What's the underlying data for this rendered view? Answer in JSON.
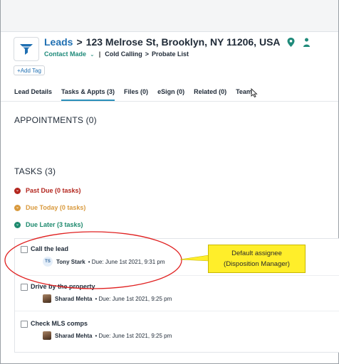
{
  "header": {
    "lead_link": "Leads",
    "separator": ">",
    "address": "123 Melrose St, Brooklyn, NY 11206, USA",
    "status": "Contact Made",
    "status_chevron": "⌄",
    "breadcrumb_divider": "|",
    "breadcrumb_1": "Cold Calling",
    "breadcrumb_arrow": ">",
    "breadcrumb_2": "Probate List",
    "add_tag": "+Add Tag",
    "icons": [
      "funnel-icon",
      "map-pin-icon",
      "person-icon"
    ]
  },
  "tabs": [
    {
      "label": "Lead Details",
      "active": false
    },
    {
      "label": "Tasks & Appts (3)",
      "active": true
    },
    {
      "label": "Files (0)",
      "active": false
    },
    {
      "label": "eSign (0)",
      "active": false
    },
    {
      "label": "Related (0)",
      "active": false
    },
    {
      "label": "Team",
      "active": false
    }
  ],
  "appointments": {
    "heading": "APPOINTMENTS (0)"
  },
  "tasks": {
    "heading": "TASKS (3)",
    "groups": [
      {
        "label": "Past Due (0 tasks)",
        "color": "#b3261e"
      },
      {
        "label": "Due Today (0 tasks)",
        "color": "#d99a3e"
      },
      {
        "label": "Due Later (3 tasks)",
        "color": "#1e8a6e"
      }
    ],
    "group_chevron": "⌄",
    "items": [
      {
        "title": "Call the lead",
        "avatar": "TS",
        "assignee": "Tony Stark",
        "due": "• Due: June 1st 2021, 9:31 pm"
      },
      {
        "title": "Drive by the property",
        "avatar": "photo",
        "assignee": "Sharad Mehta",
        "due": "• Due: June 1st 2021, 9:25 pm"
      },
      {
        "title": "Check MLS comps",
        "avatar": "photo",
        "assignee": "Sharad Mehta",
        "due": "• Due: June 1st 2021, 9:25 pm"
      }
    ]
  },
  "annotation": {
    "line_1": "Default assignee",
    "line_2": "(Disposition Manager)",
    "fill": "#ffee2a",
    "circle_color": "#e02020"
  },
  "colors": {
    "link": "#1f6fb2",
    "accent": "#2a8fb9",
    "status": "#1f8a7a"
  }
}
